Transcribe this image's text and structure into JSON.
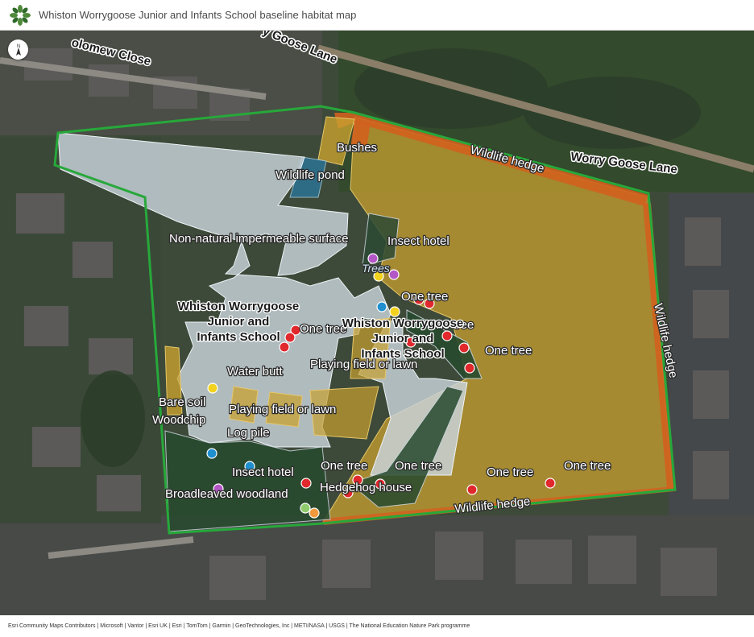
{
  "header": {
    "title": "Whiston Worrygoose Junior and Infants School baseline habitat map",
    "logo_icon": "leaf-cluster-icon"
  },
  "map": {
    "compass_icon": "north-arrow-icon",
    "roads": {
      "close": "olomew Close",
      "lane_top": "y Goose Lane",
      "lane_right": "Worry Goose Lane"
    },
    "school_labels": {
      "left": [
        "Whiston Worrygoose",
        "Junior and",
        "Infants School"
      ],
      "center": [
        "Whiston Worrygoose",
        "Junior and",
        "Infants School"
      ]
    },
    "habitat_labels": {
      "bushes": "Bushes",
      "wildlife_hedge_top": "Wildlife hedge",
      "wildlife_pond": "Wildlife pond",
      "impermeable": "Non-natural impermeable surface",
      "insect_hotel_top": "Insect hotel",
      "trees": "Trees",
      "one_tree_1": "One tree",
      "one_tree_2": "One tree",
      "one_tree_3": "One tree",
      "one_tree_4": "One tree",
      "playing_field_center": "Playing field or lawn",
      "water_butt": "Water butt",
      "wildlife_hedge_right": "Wildlife hedge",
      "bare_soil": "Bare soil",
      "woodchip": "Woodchip",
      "playing_field_left": "Playing field or lawn",
      "log_pile": "Log pile",
      "insect_hotel_bottom": "Insect hotel",
      "one_tree_5": "One tree",
      "one_tree_6": "One tree",
      "one_tree_7": "One tree",
      "one_tree_8": "One tree",
      "broadleaved": "Broadleaved woodland",
      "hedgehog_house": "Hedgehog house",
      "wildlife_hedge_bottom": "Wildlife hedge"
    },
    "colors": {
      "boundary": "#27a83a",
      "playing_field": "#c8a030",
      "impermeable": "#c9d4dc",
      "hedge": "#d2601e",
      "pond": "#2d6f8e",
      "woodland": "#274a2e",
      "point_tree": "#e0282d",
      "point_yellow": "#f2d21e",
      "point_blue": "#1f8fcf",
      "point_purple": "#b457c6",
      "point_orange": "#f39a3d",
      "point_green": "#8fca6d"
    }
  },
  "attribution": "Esri Community Maps Contributors | Microsoft | Vantor | Esri UK | Esri | TomTom | Garmin | GeoTechnologies, Inc | METI/NASA | USGS | The National Education Nature Park programme"
}
